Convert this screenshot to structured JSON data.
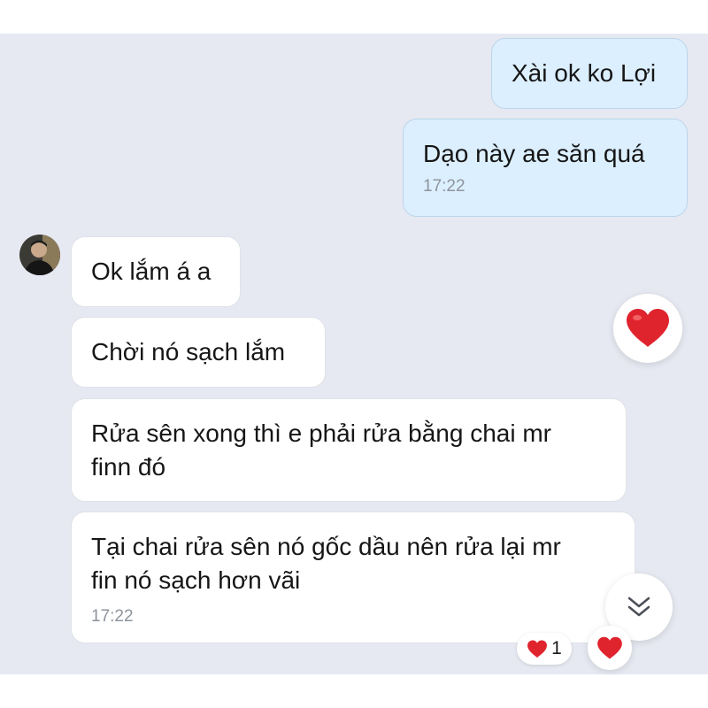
{
  "messages": {
    "m1": {
      "text": "Xài ok ko Lợi"
    },
    "m2": {
      "text": "Dạo này ae săn quá",
      "time": "17:22"
    },
    "m3": {
      "text": "Ok lắm á a"
    },
    "m4": {
      "text": "Chời nó sạch lắm"
    },
    "m5": {
      "line1": "Rửa sên xong thì e phải rửa bằng chai mr",
      "line2": "finn đó"
    },
    "m6": {
      "line1": "Tại chai rửa sên nó gốc dầu nên rửa lại mr",
      "line2": "fin nó sạch hơn vãi",
      "time": "17:22"
    }
  },
  "reaction_badge": {
    "count": "1"
  },
  "icons": {
    "quick_react": "red-heart-icon",
    "scroll_down": "double-chevron-down-icon",
    "heart_react": "red-heart-icon"
  },
  "colors": {
    "background": "#e6e9f1",
    "outgoing_bubble": "#dcefff",
    "incoming_bubble": "#ffffff",
    "heart": "#e0242e"
  }
}
